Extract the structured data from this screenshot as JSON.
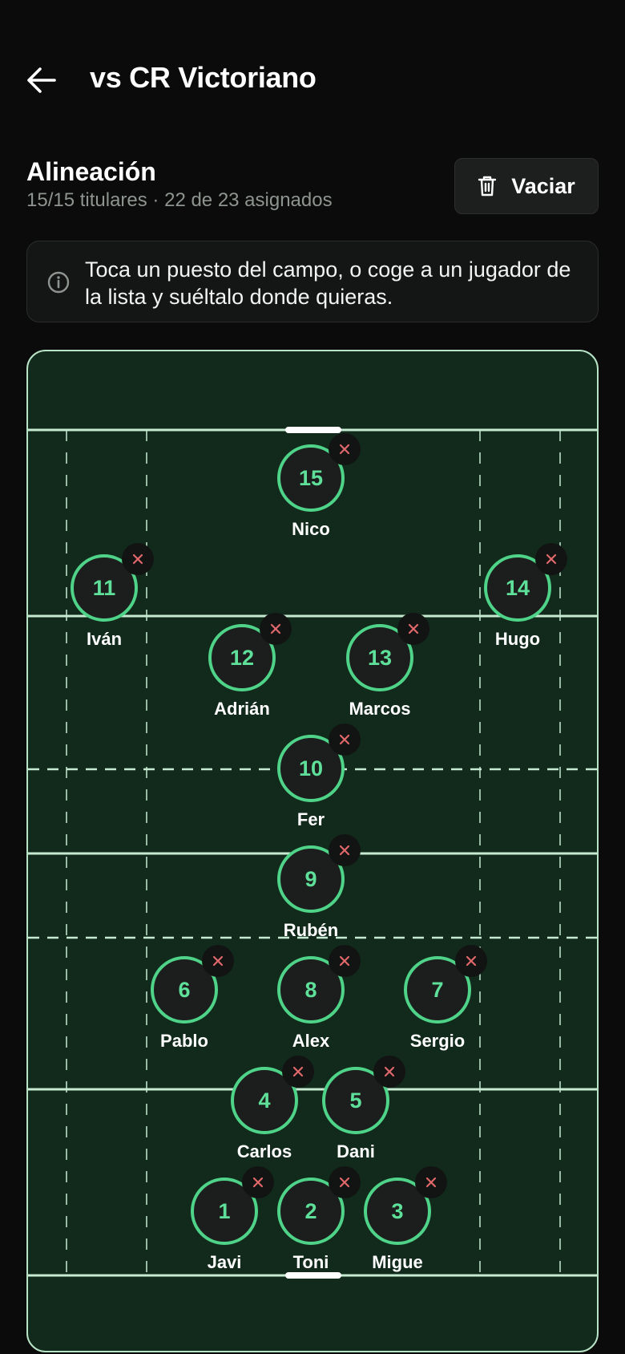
{
  "header": {
    "title": "vs CR Victoriano",
    "back_icon": "arrow-left-icon"
  },
  "lineup": {
    "title": "Alineación",
    "subtitle": "15/15 titulares · 22 de 23 asignados",
    "clear_label": "Vaciar",
    "clear_icon": "trash-icon"
  },
  "info": {
    "icon": "info-icon",
    "text": "Toca un puesto del campo, o coge a un jugador de la lista y suéltalo donde quieras."
  },
  "colors": {
    "accent": "#4fd389",
    "field": "#112a1b",
    "remove": "#e0686b"
  },
  "players": [
    {
      "number": "15",
      "name": "Nico"
    },
    {
      "number": "11",
      "name": "Iván"
    },
    {
      "number": "14",
      "name": "Hugo"
    },
    {
      "number": "12",
      "name": "Adrián"
    },
    {
      "number": "13",
      "name": "Marcos"
    },
    {
      "number": "10",
      "name": "Fer"
    },
    {
      "number": "9",
      "name": "Rubén"
    },
    {
      "number": "6",
      "name": "Pablo"
    },
    {
      "number": "8",
      "name": "Alex"
    },
    {
      "number": "7",
      "name": "Sergio"
    },
    {
      "number": "4",
      "name": "Carlos"
    },
    {
      "number": "5",
      "name": "Dani"
    },
    {
      "number": "1",
      "name": "Javi"
    },
    {
      "number": "2",
      "name": "Toni"
    },
    {
      "number": "3",
      "name": "Migue"
    }
  ]
}
